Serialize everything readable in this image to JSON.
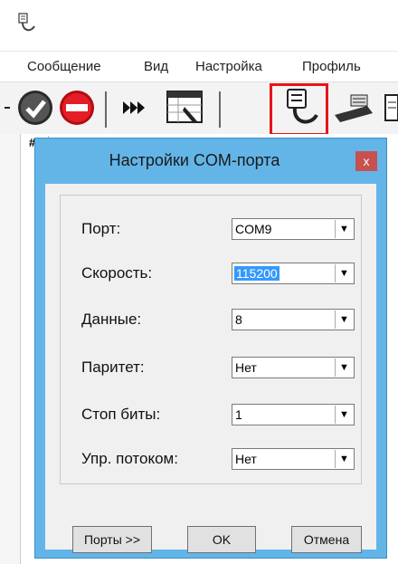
{
  "menu": [
    "Сообщение",
    "Вид",
    "Настройка",
    "Профиль"
  ],
  "dialog": {
    "title": "Настройки COM-порта",
    "close": "x",
    "fields": [
      {
        "label": "Порт:",
        "value": "COM9"
      },
      {
        "label": "Скорость:",
        "value": "115200"
      },
      {
        "label": "Данные:",
        "value": "8"
      },
      {
        "label": "Паритет:",
        "value": "Нет"
      },
      {
        "label": "Стоп биты:",
        "value": "1"
      },
      {
        "label": "Упр. потоком:",
        "value": "Нет"
      }
    ],
    "buttons": {
      "ports": "Порты >>",
      "ok": "OK",
      "cancel": "Отмена"
    }
  },
  "grid": {
    "col_hash": "#"
  },
  "colors": {
    "highlight": "#e8141b",
    "dialog_frame": "#63b5e8",
    "close_btn": "#c75050",
    "selection": "#3399ff"
  }
}
